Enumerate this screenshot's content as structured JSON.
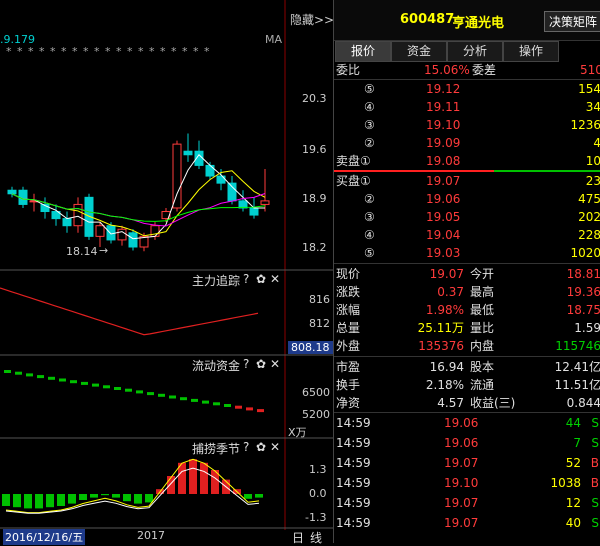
{
  "left": {
    "top_value": ".9.179",
    "asterisks": "* * *   * * *   * * * * * * * * * * * * *",
    "ma_label": "MA",
    "hide_label": "隐藏>>",
    "price_ticks": [
      "20.3",
      "19.6",
      "18.9",
      "18.2"
    ],
    "low_label": "18.14",
    "ind1": {
      "title": "主力追踪",
      "ticks": [
        "816",
        "812"
      ],
      "value": "808.18"
    },
    "ind2": {
      "title": "流动资金",
      "ticks": [
        "6500",
        "5200"
      ],
      "unit": "X万"
    },
    "ind3": {
      "title": "捕捞季节",
      "ticks": [
        "1.3",
        "0.0",
        "-1.3"
      ]
    },
    "icons": {
      "settings": "?",
      "gear": "✿",
      "close": "✕"
    },
    "date_badge": "2016/12/16/五",
    "year_label": "2017",
    "period_labels": [
      "日",
      "线"
    ]
  },
  "header": {
    "code": "600487",
    "name": "亨通光电",
    "button": "决策矩阵"
  },
  "tabs": [
    "报价",
    "资金",
    "分析",
    "操作"
  ],
  "weibi": {
    "label1": "委比",
    "value1": "15.06%",
    "label2": "委差",
    "value2": "510"
  },
  "sell": [
    {
      "label": "⑤",
      "price": "19.12",
      "vol": "154"
    },
    {
      "label": "④",
      "price": "19.11",
      "vol": "34"
    },
    {
      "label": "③",
      "price": "19.10",
      "vol": "1236"
    },
    {
      "label": "②",
      "price": "19.09",
      "vol": "4"
    },
    {
      "label": "卖盘①",
      "price": "19.08",
      "vol": "10"
    }
  ],
  "buy": [
    {
      "label": "买盘①",
      "price": "19.07",
      "vol": "23"
    },
    {
      "label": "②",
      "price": "19.06",
      "vol": "475"
    },
    {
      "label": "③",
      "price": "19.05",
      "vol": "202"
    },
    {
      "label": "④",
      "price": "19.04",
      "vol": "228"
    },
    {
      "label": "⑤",
      "price": "19.03",
      "vol": "1020"
    }
  ],
  "stats": [
    {
      "l1": "现价",
      "v1": "19.07",
      "c1": "red",
      "l2": "今开",
      "v2": "18.81",
      "c2": "red"
    },
    {
      "l1": "涨跌",
      "v1": "0.37",
      "c1": "red",
      "l2": "最高",
      "v2": "19.36",
      "c2": "red"
    },
    {
      "l1": "涨幅",
      "v1": "1.98%",
      "c1": "red",
      "l2": "最低",
      "v2": "18.75",
      "c2": "red"
    },
    {
      "l1": "总量",
      "v1": "25.11万",
      "c1": "ylw",
      "l2": "量比",
      "v2": "1.59",
      "c2": "wht"
    },
    {
      "l1": "外盘",
      "v1": "135376",
      "c1": "red",
      "l2": "内盘",
      "v2": "115746",
      "c2": "grn"
    }
  ],
  "stats2": [
    {
      "l1": "市盈",
      "v1": "16.94",
      "l2": "股本",
      "v2": "12.41亿"
    },
    {
      "l1": "换手",
      "v1": "2.18%",
      "l2": "流通",
      "v2": "11.51亿"
    },
    {
      "l1": "净资",
      "v1": "4.57",
      "l2": "收益(三)",
      "v2": "0.844"
    }
  ],
  "trades": [
    {
      "time": "14:59",
      "price": "19.06",
      "vol": "44",
      "vc": "grn",
      "side": "S",
      "sc": "grn"
    },
    {
      "time": "14:59",
      "price": "19.06",
      "vol": "7",
      "vc": "grn",
      "side": "S",
      "sc": "grn"
    },
    {
      "time": "14:59",
      "price": "19.07",
      "vol": "52",
      "vc": "ylw",
      "side": "B",
      "sc": "red"
    },
    {
      "time": "14:59",
      "price": "19.10",
      "vol": "1038",
      "vc": "ylw",
      "side": "B",
      "sc": "red"
    },
    {
      "time": "14:59",
      "price": "19.07",
      "vol": "12",
      "vc": "ylw",
      "side": "S",
      "sc": "grn"
    },
    {
      "time": "14:59",
      "price": "19.07",
      "vol": "40",
      "vc": "ylw",
      "side": "S",
      "sc": "grn"
    }
  ],
  "colors": {
    "up": "#ff3b3b",
    "down": "#00d0d0",
    "ma5": "#ffffff",
    "ma10": "#ffff00",
    "ma20": "#ff00ff",
    "ma60": "#00ff00"
  }
}
